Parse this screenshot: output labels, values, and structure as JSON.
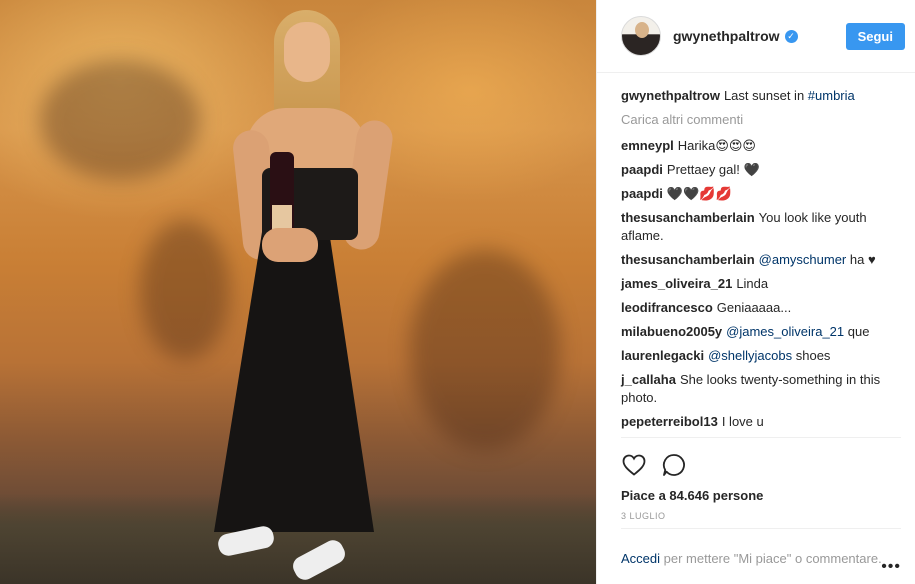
{
  "post": {
    "username": "gwynethpaltrow",
    "verified_glyph": "✓",
    "follow_label": "Segui",
    "caption": {
      "author": "gwynethpaltrow",
      "text": "Last sunset in ",
      "hashtag": "#umbria"
    },
    "load_more_label": "Carica altri commenti",
    "comments": [
      {
        "author": "emneypl",
        "text": "Harika😍😍😍"
      },
      {
        "author": "paapdi",
        "text": "Prettaey gal! 🖤"
      },
      {
        "author": "paapdi",
        "text": "🖤🖤💋💋"
      },
      {
        "author": "thesusanchamberlain",
        "text": "You look like youth aflame."
      },
      {
        "author": "thesusanchamberlain",
        "mention": "@amyschumer",
        "text": " ha ♥"
      },
      {
        "author": "james_oliveira_21",
        "text": "Linda"
      },
      {
        "author": "leodifrancesco",
        "text": "Geniaaaaa..."
      },
      {
        "author": "milabueno2005y",
        "mention": "@james_oliveira_21",
        "text": " que"
      },
      {
        "author": "laurenlegacki",
        "mention": "@shellyjacobs",
        "text": " shoes"
      },
      {
        "author": "j_callaha",
        "text": "She looks twenty-something in this photo."
      },
      {
        "author": "pepeterreibol13",
        "text": "I love u"
      }
    ],
    "likes_label": "Piace a 84.646 persone",
    "date_label": "3 luglio",
    "login_prompt": {
      "link": "Accedi",
      "text": " per mettere \"Mi piace\" o commentare."
    },
    "more_glyph": "•••"
  },
  "icons": {
    "like": "heart-outline-icon",
    "comment": "speech-bubble-icon",
    "verified": "verified-badge-icon"
  },
  "colors": {
    "accent": "#3897f0",
    "link": "#003569",
    "muted": "#999999",
    "text": "#262626"
  }
}
